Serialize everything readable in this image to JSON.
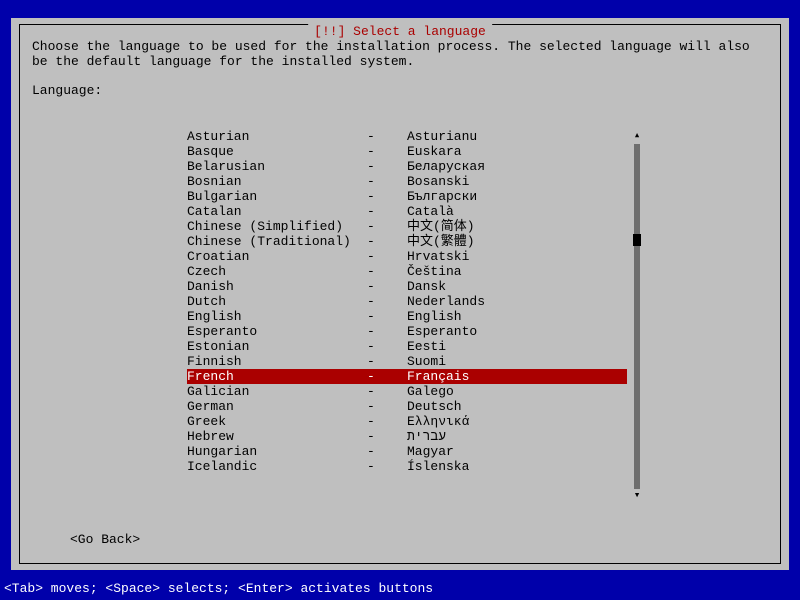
{
  "dialog": {
    "title": "[!!] Select a language",
    "instruction": "Choose the language to be used for the installation process. The selected language will also be the default language for the installed system.",
    "label": "Language:",
    "go_back": "<Go Back>"
  },
  "separator": "-",
  "selected_index": 15,
  "languages": [
    {
      "english": "Asturian",
      "native": "Asturianu"
    },
    {
      "english": "Basque",
      "native": "Euskara"
    },
    {
      "english": "Belarusian",
      "native": "Беларуская"
    },
    {
      "english": "Bosnian",
      "native": "Bosanski"
    },
    {
      "english": "Bulgarian",
      "native": "Български"
    },
    {
      "english": "Catalan",
      "native": "Català"
    },
    {
      "english": "Chinese (Simplified)",
      "native": "中文(简体)"
    },
    {
      "english": "Chinese (Traditional)",
      "native": "中文(繁體)"
    },
    {
      "english": "Croatian",
      "native": "Hrvatski"
    },
    {
      "english": "Czech",
      "native": "Čeština"
    },
    {
      "english": "Danish",
      "native": "Dansk"
    },
    {
      "english": "Dutch",
      "native": "Nederlands"
    },
    {
      "english": "English",
      "native": "English"
    },
    {
      "english": "Esperanto",
      "native": "Esperanto"
    },
    {
      "english": "Estonian",
      "native": "Eesti"
    },
    {
      "english": "Finnish",
      "native": "Suomi"
    },
    {
      "english": "French",
      "native": "Français"
    },
    {
      "english": "Galician",
      "native": "Galego"
    },
    {
      "english": "German",
      "native": "Deutsch"
    },
    {
      "english": "Greek",
      "native": "Ελληνικά"
    },
    {
      "english": "Hebrew",
      "native": "עברית"
    },
    {
      "english": "Hungarian",
      "native": "Magyar"
    },
    {
      "english": "Icelandic",
      "native": "Íslenska"
    }
  ],
  "statusbar": "<Tab> moves; <Space> selects; <Enter> activates buttons"
}
